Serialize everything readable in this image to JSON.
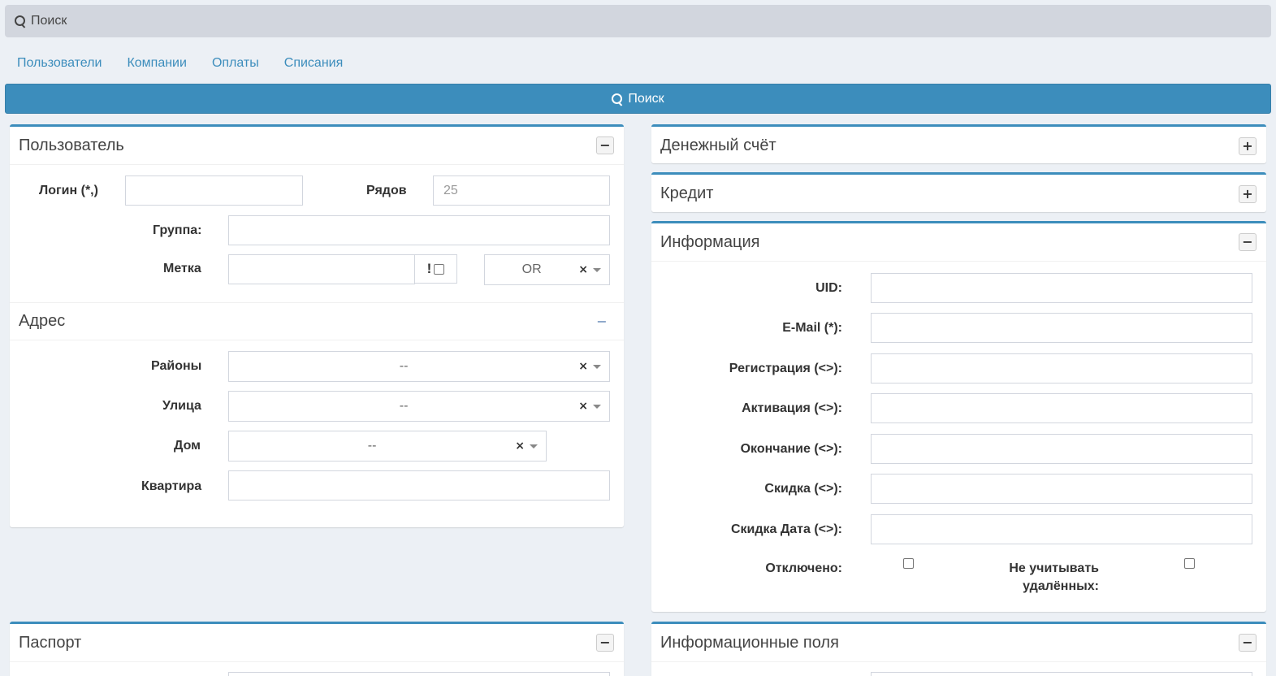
{
  "topbar": {
    "label": "Поиск"
  },
  "nav": [
    "Пользователи",
    "Компании",
    "Оплаты",
    "Списания"
  ],
  "search_button": "Поиск",
  "user_panel": {
    "title": "Пользователь",
    "login_label": "Логин (*,)",
    "rows_label": "Рядов",
    "rows_value": "25",
    "group_label": "Группа:",
    "tag_label": "Метка",
    "tag_mode": "OR",
    "address": {
      "title": "Адрес",
      "district_label": "Районы",
      "district_value": "--",
      "street_label": "Улица",
      "street_value": "--",
      "house_label": "Дом",
      "house_value": "--",
      "flat_label": "Квартира"
    }
  },
  "money_panel": {
    "title": "Денежный счёт"
  },
  "credit_panel": {
    "title": "Кредит"
  },
  "info_panel": {
    "title": "Информация",
    "fields": [
      "UID:",
      "E-Mail (*):",
      "Регистрация (<>):",
      "Активация (<>):",
      "Окончание (<>):",
      "Скидка (<>):",
      "Скидка Дата (<>):"
    ],
    "disabled_label": "Отключено:",
    "deleted_label_1": "Не учитывать",
    "deleted_label_2": "удалённых:"
  },
  "passport_panel": {
    "title": "Паспорт"
  },
  "info_fields_panel": {
    "title": "Информационные поля"
  }
}
